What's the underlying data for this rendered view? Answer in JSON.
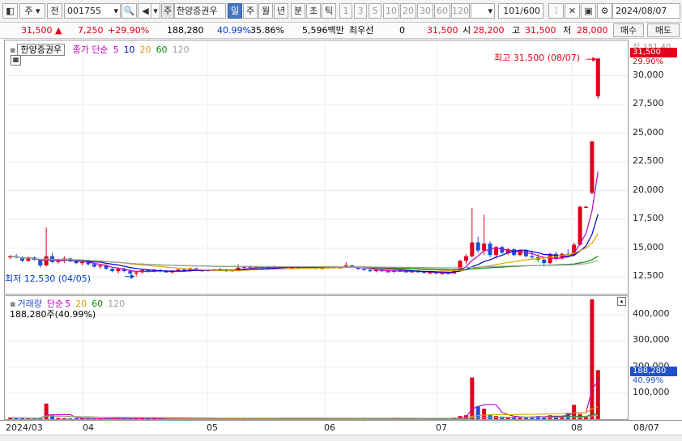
{
  "toolbar": {
    "period_type": "주",
    "prev_label": "전",
    "stock_code": "001755",
    "code_badge": "주",
    "stock_name": "한양증권우",
    "periods": [
      "일",
      "주",
      "월",
      "년",
      "분",
      "초",
      "틱"
    ],
    "selected_period": "일",
    "intervals": [
      "1",
      "3",
      "5",
      "10",
      "20",
      "30",
      "60",
      "120"
    ],
    "count_current": "101",
    "count_total": "/600",
    "date": "2024/08/07"
  },
  "quote": {
    "price": "31,500",
    "arrow": "▲",
    "change": "7,250",
    "change_pct": "+29.90%",
    "volume": "188,280",
    "volume_ratio": "40.99%",
    "turnover": "35.86%",
    "amount": "5,596백만",
    "best_label": "최우선",
    "best_value": "0",
    "last": "31,500",
    "open_label": "시",
    "open": "28,200",
    "high_label": "고",
    "high": "31,500",
    "low_label": "저",
    "low": "28,000",
    "buy_label": "매수",
    "sell_label": "매도"
  },
  "price_panel": {
    "name": "한양증권우",
    "legend_title": "종가 단순",
    "ma_periods": [
      "5",
      "10",
      "20",
      "60",
      "120"
    ],
    "ma_colors": [
      "#c000c0",
      "#0000c8",
      "#e0a000",
      "#009000",
      "#a0a0a0"
    ],
    "high_annot": "최고 31,500 (08/07)",
    "low_annot": "최저 12,530 (04/05)",
    "limit_label": "상 151.40",
    "last_price_tag": "31,500",
    "last_pct_tag": "29.90%",
    "axis_labels": [
      "30,000",
      "27,500",
      "25,000",
      "22,500",
      "20,000",
      "17,500",
      "15,000",
      "12,500"
    ]
  },
  "volume_panel": {
    "legend_title": "거래량",
    "legend_type": "단순",
    "ma_periods": [
      "5",
      "20",
      "60",
      "120"
    ],
    "ma_colors": [
      "#c000c0",
      "#e0a000",
      "#009000",
      "#a0a0a0"
    ],
    "summary": "188,280주(40.99%)",
    "last_vol_tag": "188,280",
    "last_pct_tag": "40.99%",
    "axis_labels": [
      "400,000",
      "300,000",
      "200,000",
      "100,000"
    ]
  },
  "date_axis": {
    "labels": [
      "2024/03",
      "04",
      "05",
      "06",
      "07",
      "08",
      "08/07"
    ]
  },
  "colors": {
    "up": "#e0001b",
    "down": "#1c50d8",
    "selected": "#4a78c0"
  },
  "chart_data": {
    "type": "candlestick",
    "period_start": "2024/03",
    "period_end": "2024/08/07",
    "price_ylim": [
      11600,
      32500
    ],
    "volume_ylim": [
      0,
      460000
    ],
    "candles": [
      {
        "o": 14250,
        "h": 14400,
        "l": 14050,
        "c": 14300,
        "v": 6000
      },
      {
        "o": 14300,
        "h": 14500,
        "l": 14100,
        "c": 14200,
        "v": 4000
      },
      {
        "o": 14200,
        "h": 14300,
        "l": 13800,
        "c": 13900,
        "v": 5000
      },
      {
        "o": 13900,
        "h": 14300,
        "l": 13800,
        "c": 14200,
        "v": 3000
      },
      {
        "o": 14200,
        "h": 14300,
        "l": 13900,
        "c": 14000,
        "v": 2000
      },
      {
        "o": 14000,
        "h": 14100,
        "l": 13300,
        "c": 13500,
        "v": 4000
      },
      {
        "o": 13500,
        "h": 16800,
        "l": 13400,
        "c": 14300,
        "v": 60000
      },
      {
        "o": 14300,
        "h": 14600,
        "l": 13700,
        "c": 13800,
        "v": 15000
      },
      {
        "o": 13800,
        "h": 14100,
        "l": 13600,
        "c": 13900,
        "v": 5000
      },
      {
        "o": 13900,
        "h": 14300,
        "l": 13700,
        "c": 14100,
        "v": 4000
      },
      {
        "o": 14100,
        "h": 14200,
        "l": 13800,
        "c": 13850,
        "v": 3000
      },
      {
        "o": 13850,
        "h": 14000,
        "l": 13600,
        "c": 13700,
        "v": 3000
      },
      {
        "o": 13700,
        "h": 13900,
        "l": 13500,
        "c": 13800,
        "v": 3000
      },
      {
        "o": 13800,
        "h": 13900,
        "l": 13500,
        "c": 13600,
        "v": 2000
      },
      {
        "o": 13600,
        "h": 13700,
        "l": 13300,
        "c": 13400,
        "v": 2000
      },
      {
        "o": 13400,
        "h": 13600,
        "l": 13200,
        "c": 13500,
        "v": 2000
      },
      {
        "o": 13500,
        "h": 13600,
        "l": 13100,
        "c": 13200,
        "v": 2000
      },
      {
        "o": 13200,
        "h": 13400,
        "l": 12900,
        "c": 13000,
        "v": 3000
      },
      {
        "o": 13000,
        "h": 13300,
        "l": 12800,
        "c": 13200,
        "v": 3000
      },
      {
        "o": 13200,
        "h": 13300,
        "l": 12900,
        "c": 13000,
        "v": 2000
      },
      {
        "o": 13000,
        "h": 13200,
        "l": 12700,
        "c": 12800,
        "v": 3000
      },
      {
        "o": 12800,
        "h": 13000,
        "l": 12530,
        "c": 12900,
        "v": 4000
      },
      {
        "o": 12900,
        "h": 13200,
        "l": 12800,
        "c": 13100,
        "v": 3000
      },
      {
        "o": 13100,
        "h": 13200,
        "l": 12900,
        "c": 13000,
        "v": 2000
      },
      {
        "o": 13000,
        "h": 13200,
        "l": 12900,
        "c": 13100,
        "v": 2000
      },
      {
        "o": 13100,
        "h": 13200,
        "l": 12900,
        "c": 13000,
        "v": 2000
      },
      {
        "o": 13000,
        "h": 13100,
        "l": 12850,
        "c": 12900,
        "v": 2000
      },
      {
        "o": 12900,
        "h": 13100,
        "l": 12800,
        "c": 13000,
        "v": 2000
      },
      {
        "o": 13000,
        "h": 13200,
        "l": 12900,
        "c": 13150,
        "v": 2000
      },
      {
        "o": 13150,
        "h": 13200,
        "l": 12950,
        "c": 13000,
        "v": 2000
      },
      {
        "o": 13000,
        "h": 13300,
        "l": 12950,
        "c": 13250,
        "v": 3000
      },
      {
        "o": 13250,
        "h": 13300,
        "l": 13000,
        "c": 13050,
        "v": 2000
      },
      {
        "o": 13050,
        "h": 13150,
        "l": 12950,
        "c": 13100,
        "v": 2000
      },
      {
        "o": 13100,
        "h": 13200,
        "l": 13000,
        "c": 13050,
        "v": 2000
      },
      {
        "o": 13050,
        "h": 13200,
        "l": 13000,
        "c": 13150,
        "v": 2000
      },
      {
        "o": 13150,
        "h": 13300,
        "l": 13050,
        "c": 13100,
        "v": 2000
      },
      {
        "o": 13100,
        "h": 13200,
        "l": 12950,
        "c": 13000,
        "v": 2000
      },
      {
        "o": 13000,
        "h": 13150,
        "l": 12950,
        "c": 13100,
        "v": 2000
      },
      {
        "o": 13100,
        "h": 13600,
        "l": 13050,
        "c": 13300,
        "v": 4000
      },
      {
        "o": 13300,
        "h": 13500,
        "l": 13200,
        "c": 13400,
        "v": 3000
      },
      {
        "o": 13400,
        "h": 13500,
        "l": 13250,
        "c": 13300,
        "v": 2000
      },
      {
        "o": 13300,
        "h": 13400,
        "l": 13200,
        "c": 13350,
        "v": 2000
      },
      {
        "o": 13350,
        "h": 13450,
        "l": 13200,
        "c": 13250,
        "v": 2000
      },
      {
        "o": 13250,
        "h": 13450,
        "l": 13200,
        "c": 13400,
        "v": 2000
      },
      {
        "o": 13400,
        "h": 13500,
        "l": 13300,
        "c": 13350,
        "v": 2000
      },
      {
        "o": 13350,
        "h": 13450,
        "l": 13250,
        "c": 13400,
        "v": 2000
      },
      {
        "o": 13400,
        "h": 13450,
        "l": 13250,
        "c": 13300,
        "v": 2000
      },
      {
        "o": 13300,
        "h": 13400,
        "l": 13200,
        "c": 13350,
        "v": 2000
      },
      {
        "o": 13350,
        "h": 13450,
        "l": 13250,
        "c": 13300,
        "v": 2000
      },
      {
        "o": 13300,
        "h": 13400,
        "l": 13200,
        "c": 13350,
        "v": 2000
      },
      {
        "o": 13350,
        "h": 13450,
        "l": 13250,
        "c": 13300,
        "v": 2000
      },
      {
        "o": 13300,
        "h": 13400,
        "l": 13200,
        "c": 13250,
        "v": 2000
      },
      {
        "o": 13250,
        "h": 13350,
        "l": 13150,
        "c": 13300,
        "v": 2000
      },
      {
        "o": 13300,
        "h": 13400,
        "l": 13200,
        "c": 13350,
        "v": 2000
      },
      {
        "o": 13350,
        "h": 13450,
        "l": 13250,
        "c": 13300,
        "v": 2000
      },
      {
        "o": 13300,
        "h": 13400,
        "l": 13200,
        "c": 13350,
        "v": 2000
      },
      {
        "o": 13350,
        "h": 13800,
        "l": 13300,
        "c": 13500,
        "v": 5000
      },
      {
        "o": 13500,
        "h": 13550,
        "l": 13300,
        "c": 13350,
        "v": 3000
      },
      {
        "o": 13350,
        "h": 13400,
        "l": 13100,
        "c": 13200,
        "v": 3000
      },
      {
        "o": 13200,
        "h": 13300,
        "l": 13050,
        "c": 13100,
        "v": 3000
      },
      {
        "o": 13100,
        "h": 13200,
        "l": 12950,
        "c": 13000,
        "v": 3000
      },
      {
        "o": 13000,
        "h": 13150,
        "l": 12900,
        "c": 13100,
        "v": 2000
      },
      {
        "o": 13100,
        "h": 13200,
        "l": 12950,
        "c": 13000,
        "v": 2000
      },
      {
        "o": 13000,
        "h": 13100,
        "l": 12900,
        "c": 12950,
        "v": 2000
      },
      {
        "o": 12950,
        "h": 13100,
        "l": 12850,
        "c": 13050,
        "v": 2000
      },
      {
        "o": 13050,
        "h": 13150,
        "l": 12950,
        "c": 13000,
        "v": 2000
      },
      {
        "o": 13000,
        "h": 13100,
        "l": 12900,
        "c": 12950,
        "v": 2000
      },
      {
        "o": 12950,
        "h": 13050,
        "l": 12850,
        "c": 13000,
        "v": 2000
      },
      {
        "o": 13000,
        "h": 13100,
        "l": 12900,
        "c": 12950,
        "v": 2000
      },
      {
        "o": 12950,
        "h": 13050,
        "l": 12800,
        "c": 12850,
        "v": 2000
      },
      {
        "o": 12850,
        "h": 12950,
        "l": 12750,
        "c": 12900,
        "v": 2000
      },
      {
        "o": 12900,
        "h": 12950,
        "l": 12750,
        "c": 12800,
        "v": 2000
      },
      {
        "o": 12800,
        "h": 12900,
        "l": 12700,
        "c": 12850,
        "v": 2000
      },
      {
        "o": 12850,
        "h": 12950,
        "l": 12750,
        "c": 12800,
        "v": 2000
      },
      {
        "o": 12800,
        "h": 13200,
        "l": 12750,
        "c": 13100,
        "v": 6000
      },
      {
        "o": 13100,
        "h": 14000,
        "l": 13000,
        "c": 13900,
        "v": 12000
      },
      {
        "o": 13900,
        "h": 14500,
        "l": 13600,
        "c": 14300,
        "v": 15000
      },
      {
        "o": 14300,
        "h": 18500,
        "l": 14200,
        "c": 15500,
        "v": 160000
      },
      {
        "o": 15500,
        "h": 16000,
        "l": 14600,
        "c": 14800,
        "v": 50000
      },
      {
        "o": 14800,
        "h": 17900,
        "l": 14400,
        "c": 15400,
        "v": 40000
      },
      {
        "o": 15400,
        "h": 15600,
        "l": 14200,
        "c": 14400,
        "v": 18000
      },
      {
        "o": 14400,
        "h": 15200,
        "l": 14100,
        "c": 15100,
        "v": 12000
      },
      {
        "o": 15100,
        "h": 15200,
        "l": 14500,
        "c": 14600,
        "v": 10000
      },
      {
        "o": 14600,
        "h": 15000,
        "l": 14400,
        "c": 14900,
        "v": 8000
      },
      {
        "o": 14900,
        "h": 15000,
        "l": 14300,
        "c": 14400,
        "v": 8000
      },
      {
        "o": 14400,
        "h": 14900,
        "l": 14300,
        "c": 14800,
        "v": 7000
      },
      {
        "o": 14800,
        "h": 14900,
        "l": 14200,
        "c": 14300,
        "v": 8000
      },
      {
        "o": 14300,
        "h": 14800,
        "l": 14000,
        "c": 14200,
        "v": 10000
      },
      {
        "o": 14200,
        "h": 14500,
        "l": 13800,
        "c": 14000,
        "v": 12000
      },
      {
        "o": 14000,
        "h": 14100,
        "l": 13400,
        "c": 13700,
        "v": 10000
      },
      {
        "o": 13700,
        "h": 14600,
        "l": 13600,
        "c": 14500,
        "v": 15000
      },
      {
        "o": 14500,
        "h": 14700,
        "l": 13900,
        "c": 14100,
        "v": 10000
      },
      {
        "o": 14100,
        "h": 14600,
        "l": 14000,
        "c": 14500,
        "v": 12000
      },
      {
        "o": 14500,
        "h": 14900,
        "l": 14200,
        "c": 14400,
        "v": 25000
      },
      {
        "o": 14400,
        "h": 15500,
        "l": 14300,
        "c": 15300,
        "v": 55000
      },
      {
        "o": 15300,
        "h": 18700,
        "l": 15200,
        "c": 18600,
        "v": 20000
      },
      {
        "o": 18600,
        "h": 18700,
        "l": 18500,
        "c": 18600,
        "v": 10000
      },
      {
        "o": 19800,
        "h": 24300,
        "l": 19700,
        "c": 24300,
        "v": 460000
      },
      {
        "o": 28200,
        "h": 31500,
        "l": 28000,
        "c": 31500,
        "v": 188280
      }
    ]
  }
}
